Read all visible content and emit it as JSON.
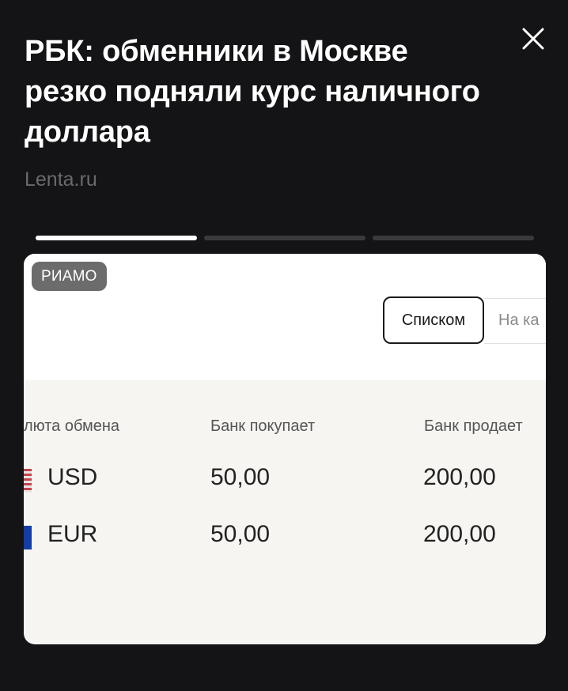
{
  "headline": "РБК: обменники в Москве резко подняли курс наличного доллара",
  "source": "Lenta.ru",
  "close_icon": "close-icon",
  "story_progress": {
    "total": 3,
    "current": 1
  },
  "card": {
    "badge": "РИАМО",
    "view_toggle": {
      "active": "Списком",
      "other": "На ка"
    },
    "table": {
      "headers": [
        "люта обмена",
        "Банк покупает",
        "Банк продает"
      ],
      "rows": [
        {
          "flag": "usa-flag-icon",
          "currency": "USD",
          "buy": "50,00",
          "sell": "200,00"
        },
        {
          "flag": "eu-flag-icon",
          "currency": "EUR",
          "buy": "50,00",
          "sell": "200,00"
        }
      ]
    }
  },
  "colors": {
    "background": "#141416",
    "headline": "#ffffff",
    "source": "#6a6a6e",
    "progress_active": "#ffffff",
    "progress_inactive": "#3a3a3e"
  }
}
